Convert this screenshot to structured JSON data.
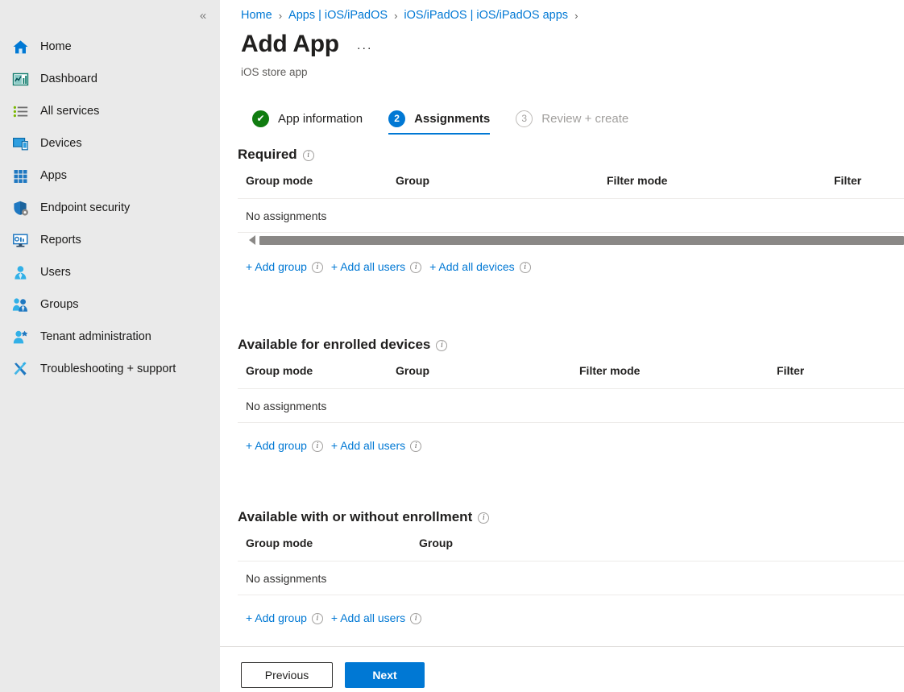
{
  "sidebar": {
    "collapse_label": "«",
    "items": [
      {
        "label": "Home",
        "icon": "home-icon"
      },
      {
        "label": "Dashboard",
        "icon": "dashboard-icon"
      },
      {
        "label": "All services",
        "icon": "all-services-icon"
      },
      {
        "label": "Devices",
        "icon": "devices-icon"
      },
      {
        "label": "Apps",
        "icon": "apps-icon"
      },
      {
        "label": "Endpoint security",
        "icon": "shield-icon"
      },
      {
        "label": "Reports",
        "icon": "reports-icon"
      },
      {
        "label": "Users",
        "icon": "user-icon"
      },
      {
        "label": "Groups",
        "icon": "groups-icon"
      },
      {
        "label": "Tenant administration",
        "icon": "tenant-admin-icon"
      },
      {
        "label": "Troubleshooting + support",
        "icon": "tools-icon"
      }
    ]
  },
  "breadcrumb": {
    "items": [
      "Home",
      "Apps | iOS/iPadOS",
      "iOS/iPadOS | iOS/iPadOS apps"
    ],
    "separator": "›"
  },
  "header": {
    "title": "Add App",
    "ellipsis": "···",
    "subtitle": "iOS store app"
  },
  "tabs": [
    {
      "badge": "✔",
      "label": "App information",
      "state": "done"
    },
    {
      "badge": "2",
      "label": "Assignments",
      "state": "active"
    },
    {
      "badge": "3",
      "label": "Review + create",
      "state": "idle"
    }
  ],
  "info_glyph": "i",
  "sections": [
    {
      "title": "Required",
      "columns": [
        "Group mode",
        "Group",
        "Filter mode",
        "Filter"
      ],
      "column_x": [
        10,
        196,
        458,
        740
      ],
      "empty_text": "No assignments",
      "has_scrollbar": true,
      "links": [
        "+ Add group",
        "+ Add all users",
        "+ Add all devices"
      ]
    },
    {
      "title": "Available for enrolled devices",
      "columns": [
        "Group mode",
        "Group",
        "Filter mode",
        "Filter"
      ],
      "column_x": [
        10,
        196,
        424,
        669
      ],
      "empty_text": "No assignments",
      "has_scrollbar": false,
      "links": [
        "+ Add group",
        "+ Add all users"
      ]
    },
    {
      "title": "Available with or without enrollment",
      "columns": [
        "Group mode",
        "Group"
      ],
      "column_x": [
        10,
        225
      ],
      "empty_text": "No assignments",
      "has_scrollbar": false,
      "links": [
        "+ Add group",
        "+ Add all users"
      ]
    }
  ],
  "footer": {
    "previous_label": "Previous",
    "next_label": "Next"
  },
  "colors": {
    "accent": "#0078d4",
    "success": "#107c10",
    "sidebar_bg": "#eaeaea",
    "divider": "#edebe9",
    "scrollbar": "#8a8886"
  }
}
